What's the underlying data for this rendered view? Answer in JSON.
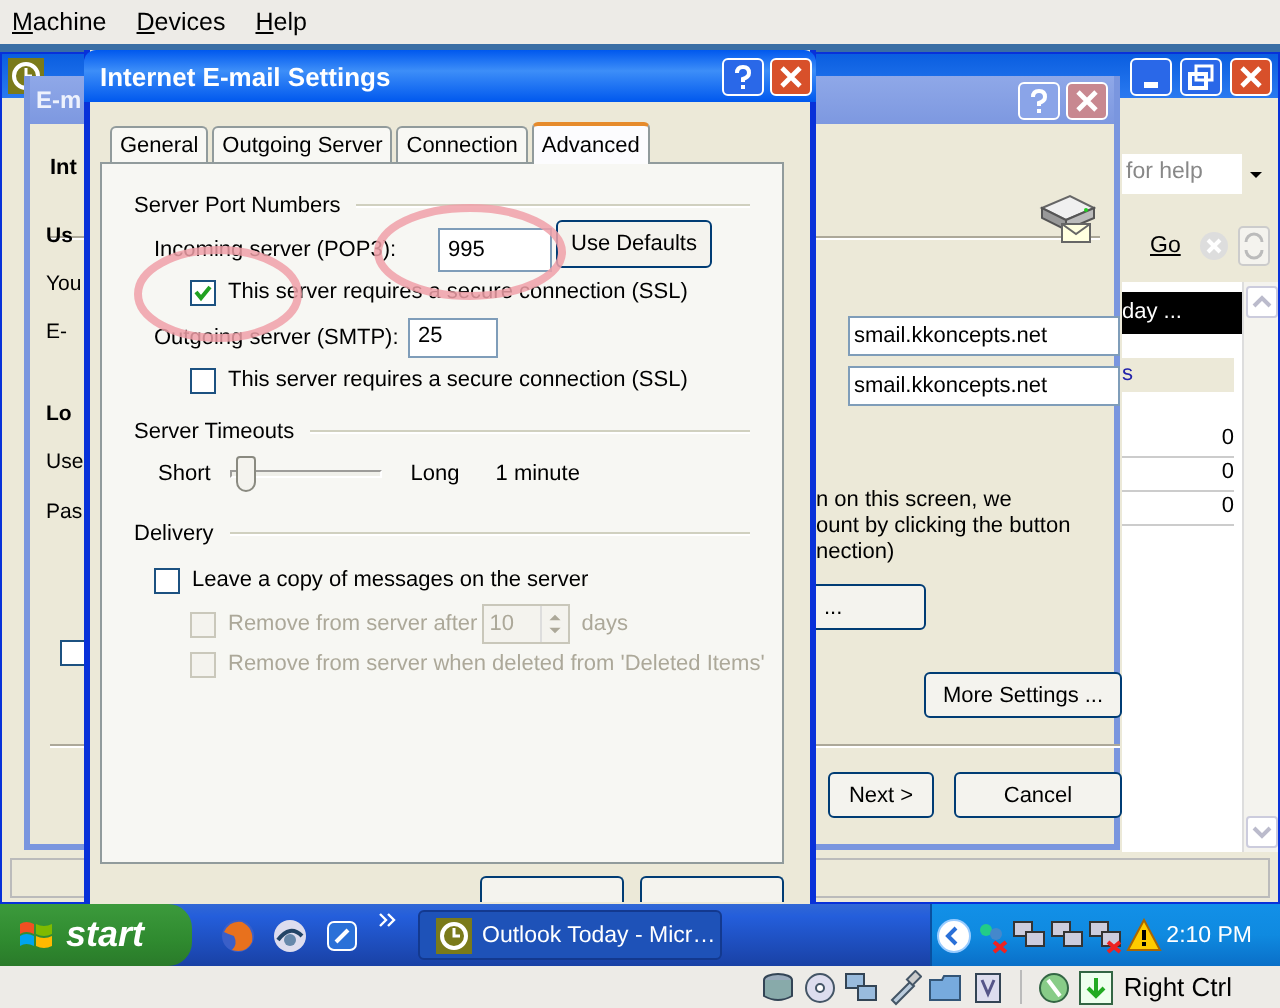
{
  "menu": [
    {
      "label": "Machine"
    },
    {
      "label": "Devices"
    },
    {
      "label": "Help"
    }
  ],
  "outlook_window": {
    "help_box": {
      "placeholder": "for help"
    },
    "go_link": "Go",
    "panel_header": "day ...",
    "panel_row": "s",
    "counts": [
      "0",
      "0",
      "0"
    ]
  },
  "accounts_wizard": {
    "title": "E-m",
    "heading": "Int",
    "left_labels": [
      {
        "kind": "heading",
        "text": "Us"
      },
      {
        "kind": "label",
        "text": "You"
      },
      {
        "kind": "label",
        "text": "E-"
      },
      {
        "kind": "heading",
        "text": "Lo"
      },
      {
        "kind": "label",
        "text": "Use"
      },
      {
        "kind": "label",
        "text": "Pas"
      }
    ],
    "fields": [
      "smail.kkoncepts.net",
      "smail.kkoncepts.net"
    ],
    "note_lines": [
      "n on this screen, we",
      "ount by clicking the button",
      "nection)"
    ],
    "test_button": "...",
    "remember_checkbox": {
      "checked": false
    },
    "more_settings_button": "More Settings ...",
    "buttons": [
      "Next >",
      "Cancel"
    ]
  },
  "settings_dialog": {
    "title": "Internet E-mail Settings",
    "tabs": [
      {
        "label": "General",
        "selected": false
      },
      {
        "label": "Outgoing Server",
        "selected": false
      },
      {
        "label": "Connection",
        "selected": false
      },
      {
        "label": "Advanced",
        "selected": true
      }
    ],
    "server_ports": {
      "heading": "Server Port Numbers",
      "incoming_label": "Incoming server (POP3):",
      "incoming_port": "995",
      "use_defaults_button": "Use Defaults",
      "incoming_ssl": {
        "label": "This server requires a secure connection (SSL)",
        "checked": true
      },
      "outgoing_label": "Outgoing server (SMTP):",
      "outgoing_port": "25",
      "outgoing_ssl": {
        "label": "This server requires a secure connection (SSL)",
        "checked": false
      }
    },
    "timeouts": {
      "heading": "Server Timeouts",
      "min_label": "Short",
      "max_label": "Long",
      "level": 0.1,
      "reading": "1 minute"
    },
    "delivery": {
      "heading": "Delivery",
      "options": [
        {
          "kind": "checkbox",
          "label": "Leave a copy of messages on the server",
          "checked": false,
          "disabled": false
        },
        {
          "kind": "checkbox_days",
          "label": "Remove from server after",
          "value": "10",
          "unit": "days",
          "checked": false,
          "disabled": true
        },
        {
          "kind": "checkbox",
          "label": "Remove from server when deleted from 'Deleted Items'",
          "checked": false,
          "disabled": true
        }
      ]
    },
    "bottom_buttons_partly_hidden": {
      "kind": "button_tops"
    }
  },
  "taskbar": {
    "start": "start",
    "task": "Outlook Today - Micr…",
    "clock": "2:10 PM"
  },
  "status_bar": {
    "host_key": "Right Ctrl"
  }
}
